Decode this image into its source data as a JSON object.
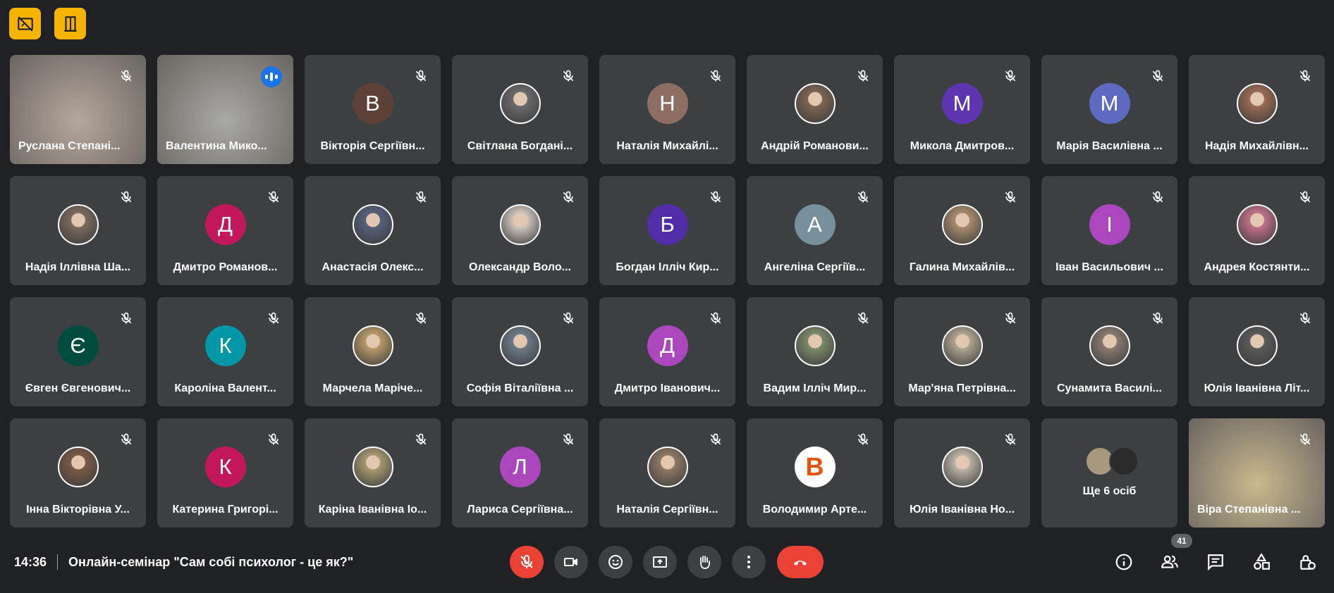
{
  "top_controls": {
    "left_icon": "video-off-icon",
    "right_icon": "door-icon",
    "accent": "#f6b400"
  },
  "participants": [
    {
      "name": "Руслана Степані...",
      "type": "video",
      "color": "#b6a79c",
      "muted": true
    },
    {
      "name": "Валентина Мико...",
      "type": "video",
      "color": "#a9a9a5",
      "speaking": true,
      "active": true
    },
    {
      "name": "Вікторія Сергіївн...",
      "type": "letter",
      "letter": "В",
      "color": "#5d4037",
      "muted": true
    },
    {
      "name": "Світлана Богдані...",
      "type": "photo",
      "color": "#6a6a6a",
      "muted": true
    },
    {
      "name": "Наталія Михайлі...",
      "type": "letter",
      "letter": "Н",
      "color": "#8d6e63",
      "muted": true
    },
    {
      "name": "Андрій Романови...",
      "type": "photo",
      "color": "#7d6453",
      "muted": true
    },
    {
      "name": "Микола Дмитров...",
      "type": "letter",
      "letter": "М",
      "color": "#5e35b1",
      "muted": true
    },
    {
      "name": "Марія Василівна ...",
      "type": "letter",
      "letter": "М",
      "color": "#5c6bc0",
      "muted": true
    },
    {
      "name": "Надія Михайлівн...",
      "type": "photo",
      "color": "#9a6b55",
      "muted": true
    },
    {
      "name": "Надія Іллівна Ша...",
      "type": "photo",
      "color": "#7a6a5e",
      "muted": true
    },
    {
      "name": "Дмитро Романов...",
      "type": "letter",
      "letter": "Д",
      "color": "#c2185b",
      "muted": true
    },
    {
      "name": "Анастасія Олекс...",
      "type": "photo",
      "color": "#55607a",
      "muted": true
    },
    {
      "name": "Олександр Воло...",
      "type": "photo",
      "color": "#cfc6bd",
      "muted": true
    },
    {
      "name": "Богдан Ілліч Кир...",
      "type": "letter",
      "letter": "Б",
      "color": "#512da8",
      "muted": true
    },
    {
      "name": "Ангеліна Сергіїв...",
      "type": "letter",
      "letter": "А",
      "color": "#78909c",
      "muted": true
    },
    {
      "name": "Галина Михайлів...",
      "type": "photo",
      "color": "#a88b6e",
      "muted": true
    },
    {
      "name": "Іван Васильович ...",
      "type": "letter",
      "letter": "І",
      "color": "#ab47bc",
      "muted": true
    },
    {
      "name": "Андрея Костянти...",
      "type": "photo",
      "color": "#c0708a",
      "muted": true
    },
    {
      "name": "Євген Євгенович...",
      "type": "letter",
      "letter": "Є",
      "color": "#004d40",
      "muted": true
    },
    {
      "name": "Кароліна Валент...",
      "type": "letter",
      "letter": "К",
      "color": "#0097a7",
      "muted": true
    },
    {
      "name": "Марчела Маріче...",
      "type": "photo",
      "color": "#b89a6a",
      "muted": true
    },
    {
      "name": "Софія Віталіївна ...",
      "type": "photo",
      "color": "#6b7a86",
      "muted": true
    },
    {
      "name": "Дмитро Іванович...",
      "type": "letter",
      "letter": "Д",
      "color": "#ab47bc",
      "muted": true
    },
    {
      "name": "Вадим Ілліч Мир...",
      "type": "photo",
      "color": "#7c8a6a",
      "muted": true
    },
    {
      "name": "Мар'яна Петрівна...",
      "type": "photo",
      "color": "#b0a592",
      "muted": true
    },
    {
      "name": "Сунамита Василі...",
      "type": "photo",
      "color": "#8a7a70",
      "muted": true
    },
    {
      "name": "Юлія Іванівна Літ...",
      "type": "photo",
      "color": "#5a5a5a",
      "muted": true
    },
    {
      "name": "Інна Вікторівна У...",
      "type": "photo",
      "color": "#7a5a46",
      "muted": true
    },
    {
      "name": "Катерина Григорі...",
      "type": "letter",
      "letter": "К",
      "color": "#c2185b",
      "muted": true
    },
    {
      "name": "Каріна Іванівна Іо...",
      "type": "photo",
      "color": "#a79a72",
      "muted": true
    },
    {
      "name": "Лариса Сергіївна...",
      "type": "letter",
      "letter": "Л",
      "color": "#ab47bc",
      "muted": true
    },
    {
      "name": "Наталія Сергіївн...",
      "type": "photo",
      "color": "#8f7865",
      "muted": true
    },
    {
      "name": "Володимир Арте...",
      "type": "logo",
      "letter": "B",
      "color": "#ffffff",
      "muted": true
    },
    {
      "name": "Юлія Іванівна Но...",
      "type": "photo",
      "color": "#bdb3a6",
      "muted": true
    },
    {
      "name": "Ще 6 осіб",
      "type": "more",
      "muted": false
    },
    {
      "name": "Віра Степанівна ...",
      "type": "video",
      "color": "#c9b98e",
      "muted": true
    }
  ],
  "bottom_bar": {
    "time": "14:36",
    "meeting_title": "Онлайн-семінар \"Сам собі психолог - це як?\"",
    "participant_count": "41",
    "controls": [
      "mic-off-icon",
      "camera-icon",
      "emoji-icon",
      "present-icon",
      "raise-hand-icon",
      "more-options-icon",
      "hang-up-icon"
    ],
    "right_controls": [
      "info-icon",
      "people-icon",
      "chat-icon",
      "activities-icon",
      "host-controls-icon"
    ]
  }
}
